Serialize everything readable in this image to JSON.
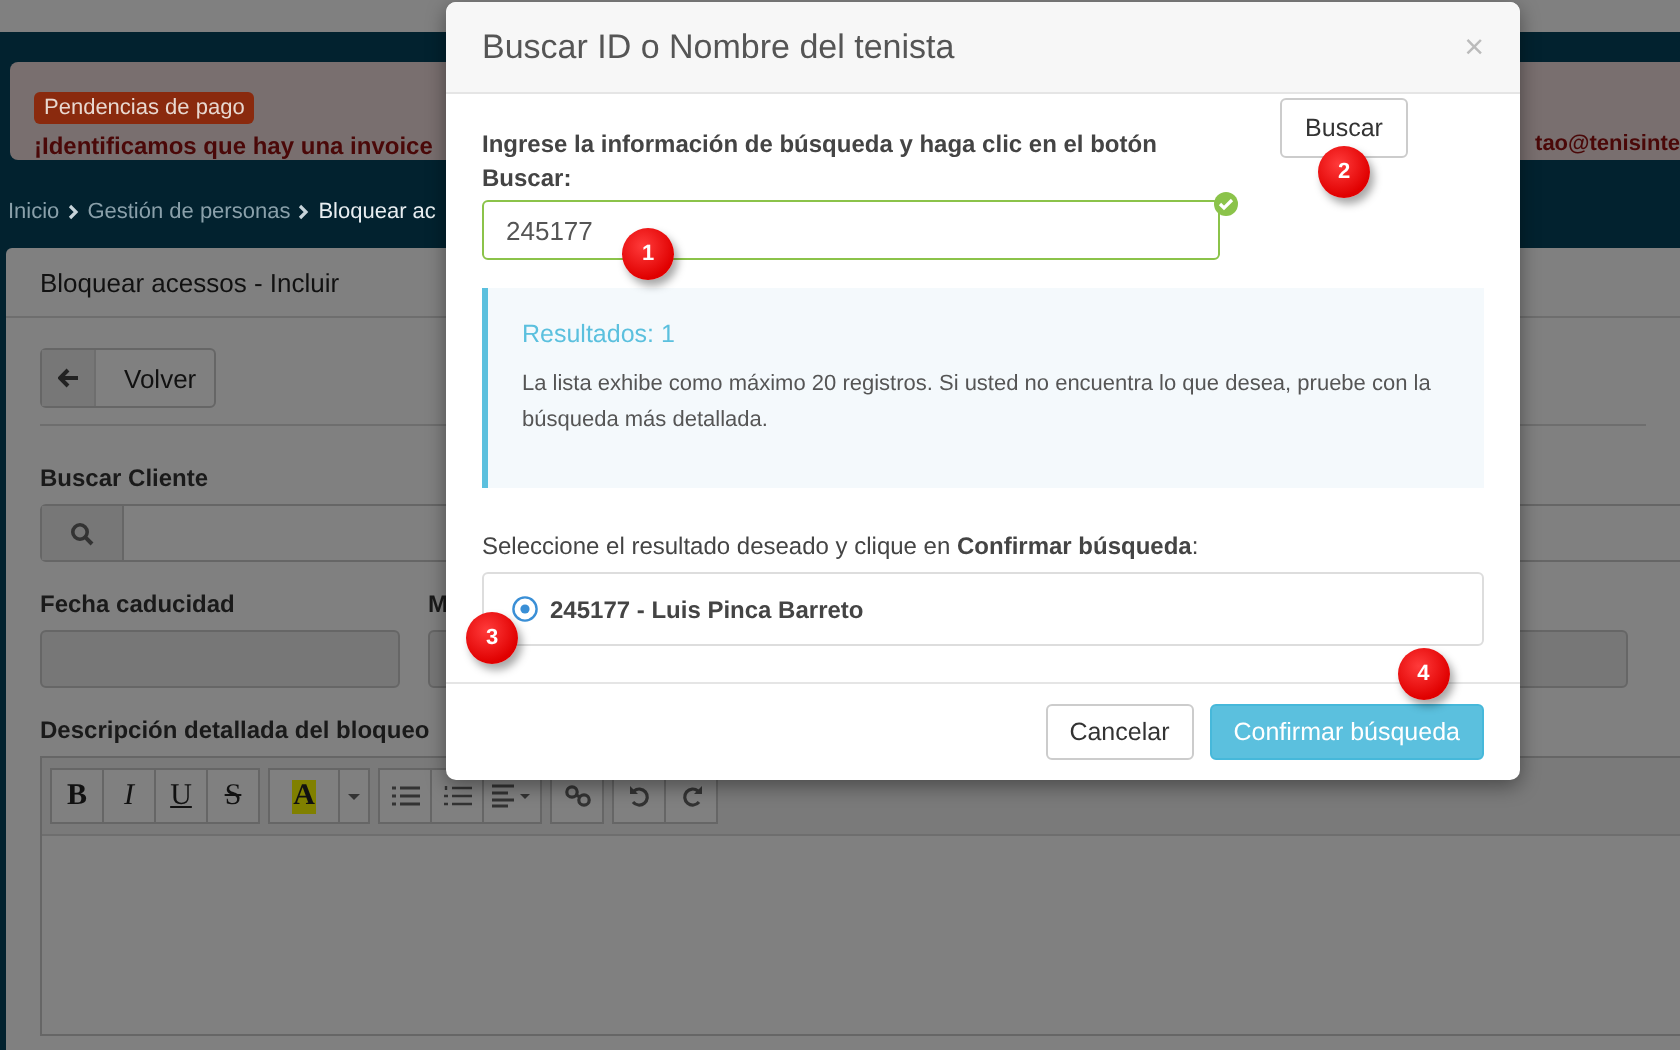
{
  "page": {
    "alert": {
      "badge": "Pendencias de pago",
      "message": "¡Identificamos que hay una invoice",
      "message_right": "tao@tenisinte"
    },
    "breadcrumb": [
      {
        "label": "Inicio",
        "current": false
      },
      {
        "label": "Gestión de personas",
        "current": false
      },
      {
        "label": "Bloquear ac",
        "current": true
      }
    ],
    "card": {
      "title": "Bloquear acessos - Incluir",
      "back_button": "Volver",
      "search_label": "Buscar Cliente",
      "date_fields": [
        {
          "label": "Fecha caducidad"
        },
        {
          "label": "M"
        }
      ],
      "editor_label": "Descripción detallada del bloqueo",
      "toolbar": [
        [
          {
            "kind": "bold",
            "label": "B"
          },
          {
            "kind": "italic",
            "label": "I"
          },
          {
            "kind": "underline",
            "label": "U"
          },
          {
            "kind": "strike",
            "label": "S"
          }
        ],
        [
          {
            "kind": "color",
            "label": "A"
          },
          {
            "kind": "caret"
          }
        ],
        [
          {
            "kind": "bullets"
          },
          {
            "kind": "numbers"
          },
          {
            "kind": "align"
          }
        ],
        [
          {
            "kind": "link"
          }
        ],
        [
          {
            "kind": "undo"
          },
          {
            "kind": "redo"
          }
        ]
      ]
    }
  },
  "modal": {
    "title": "Buscar ID o Nombre del tenista",
    "close": "×",
    "instruction": "Ingrese la información de búsqueda y haga clic en el botón Buscar:",
    "search": {
      "value": "245177",
      "valid": true,
      "marker": "1"
    },
    "search_button": {
      "label": "Buscar",
      "marker": "2"
    },
    "info": {
      "title": "Resultados: 1",
      "text": "La lista exhibe como máximo 20 registros. Si usted no encuentra lo que desea, pruebe con la búsqueda más detallada."
    },
    "select_prompt": "Seleccione el resultado deseado y clique en **Confirmar búsqueda**:",
    "results": [
      {
        "label": "245177 - Luis Pinca Barreto",
        "selected": true,
        "marker": "3"
      }
    ],
    "buttons": [
      {
        "label": "Cancelar",
        "kind": "default"
      },
      {
        "label": "Confirmar búsqueda",
        "kind": "primary",
        "marker": "4"
      }
    ]
  }
}
